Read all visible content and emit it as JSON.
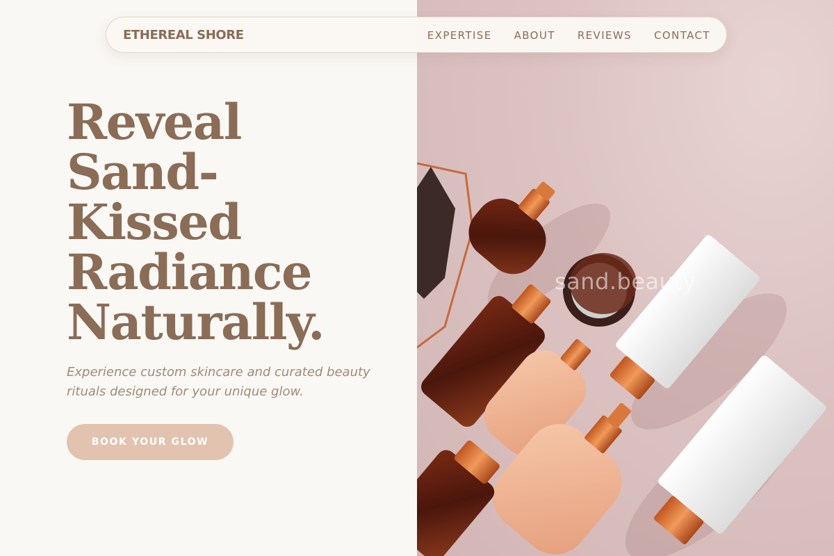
{
  "nav": {
    "brand": "ETHEREAL SHORE",
    "links": [
      "EXPERTISE",
      "ABOUT",
      "REVIEWS",
      "CONTACT"
    ]
  },
  "hero": {
    "headline_lines": [
      "Reveal",
      "Sand-",
      "Kissed",
      "Radiance",
      "Naturally."
    ],
    "subtitle": "Experience custom skincare and curated beauty rituals designed for your unique glow.",
    "cta_label": "BOOK YOUR GLOW",
    "image_watermark": "sand.beauty"
  },
  "colors": {
    "page_background": "#faf8f4",
    "brand_text": "#8a6c57",
    "cta_background": "#e2c3b0",
    "image_background": "#dcc3c2"
  },
  "icons": {
    "hero_image": "cosmetics-bottles-photo"
  }
}
